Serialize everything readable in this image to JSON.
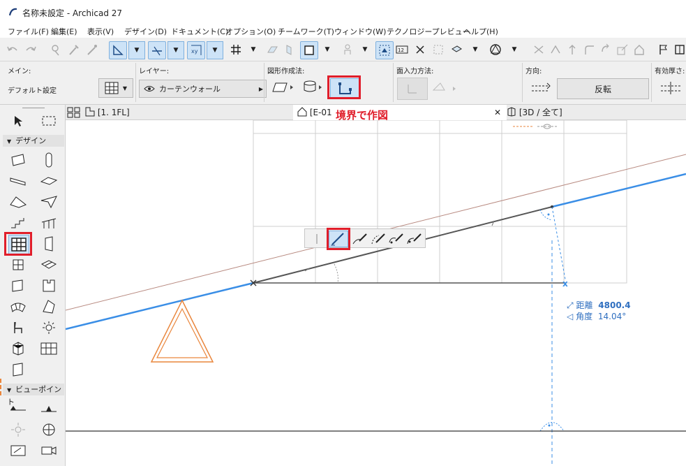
{
  "window": {
    "title": "名称未設定 - Archicad 27"
  },
  "menu": [
    "ファイル(F)",
    "編集(E)",
    "表示(V)",
    "デザイン(D)",
    "ドキュメント(C)",
    "オプション(O)",
    "チームワーク(T)",
    "ウィンドウ(W)",
    "テクノロジープレビュー",
    "ヘルプ(H)"
  ],
  "infobox": {
    "main_label": "メイン:",
    "main_value": "デフォルト設定",
    "layer_label": "レイヤー:",
    "layer_value": "カーテンウォール",
    "geometry_label": "図形作成法:",
    "plane_label": "面入力方法:",
    "direction_label": "方向:",
    "flip_label": "反転",
    "thickness_label": "有効厚さ:"
  },
  "toolbox": {
    "design_label": "デザイン",
    "viewpoint_label": "ビューポイント"
  },
  "tabs": {
    "plan": "[1. 1FL]",
    "elevation": "[E-01",
    "threed": "[3D / 全て]"
  },
  "annotation": {
    "text": "境界で作図"
  },
  "tracker": {
    "distance_label": "距離",
    "distance_value": "4800.4",
    "angle_label": "角度",
    "angle_value": "14.04°"
  },
  "colors": {
    "accent_red": "#e01e2b",
    "blue_line": "#3a8ee6",
    "brown_line": "#b88a80",
    "orange": "#e9863c",
    "highlight": "#cde3f7"
  }
}
